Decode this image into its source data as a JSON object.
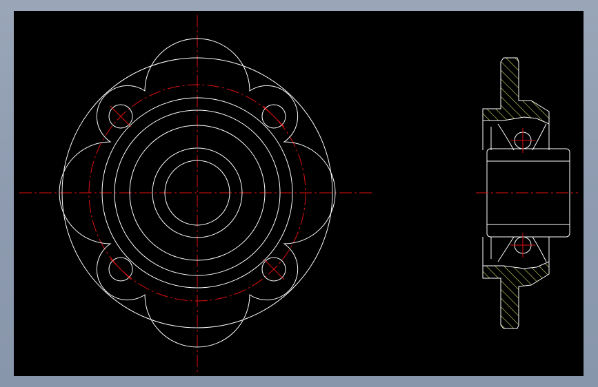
{
  "drawing": {
    "background": "#000000",
    "outline_color": "#ffffff",
    "centerline_color": "#e01010",
    "hatch_color": "#d8e060"
  }
}
